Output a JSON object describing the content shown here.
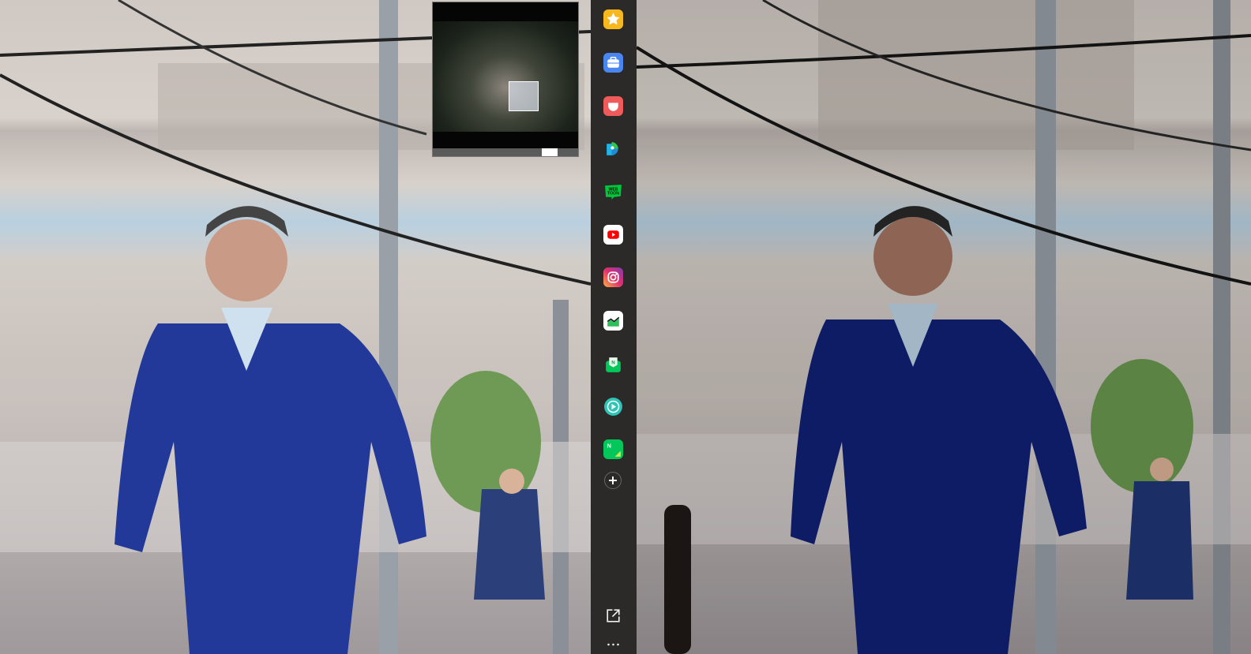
{
  "viewer": {
    "panes": [
      {
        "name": "left-photo",
        "filter": "original"
      },
      {
        "name": "right-photo",
        "filter": "adjusted"
      }
    ]
  },
  "sidebar": {
    "background": "#2b2a29",
    "apps": [
      {
        "icon": "bookmark-star-icon",
        "color": "#f6b81d"
      },
      {
        "icon": "briefcase-icon",
        "color": "#4a86f0"
      },
      {
        "icon": "pocket-icon",
        "color": "#ef5a5a"
      },
      {
        "icon": "papago-translator-icon",
        "color": "#1fb5ea"
      },
      {
        "icon": "webtoon-icon",
        "color": "#00c73c"
      },
      {
        "icon": "youtube-icon",
        "color": "#ff0000"
      },
      {
        "icon": "instagram-icon",
        "color": "#d6249f"
      },
      {
        "icon": "stock-chart-icon",
        "color": "#2dbf5a"
      },
      {
        "icon": "naver-mail-icon",
        "color": "#03c75a"
      },
      {
        "icon": "media-play-icon",
        "color": "#2ec4b6"
      },
      {
        "icon": "naver-memo-icon",
        "color": "#03c75a"
      }
    ],
    "add_icon": "plus-circle-icon",
    "popout_icon": "external-link-icon",
    "more_icon": "more-dots-icon"
  }
}
